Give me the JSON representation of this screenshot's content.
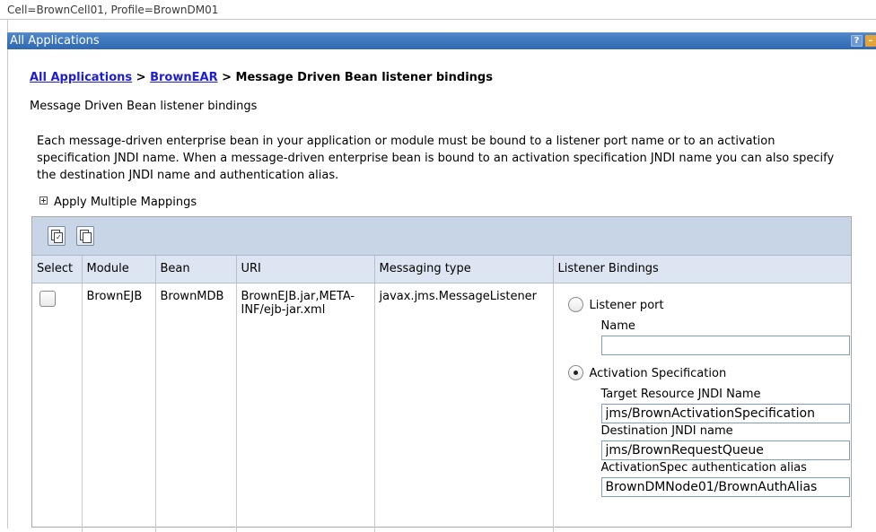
{
  "header": {
    "context": "Cell=BrownCell01, Profile=BrownDM01"
  },
  "panel": {
    "title": "All Applications",
    "help_label": "?",
    "minimize_label": "–"
  },
  "breadcrumb": {
    "link1": "All Applications",
    "sep1": " > ",
    "link2": "BrownEAR",
    "sep2": " > ",
    "current": "Message Driven Bean listener bindings"
  },
  "page": {
    "subtitle": "Message Driven Bean listener bindings",
    "description": "Each message-driven enterprise bean in your application or module must be bound to a listener port name or to an activation specification JNDI name. When a message-driven enterprise bean is bound to an activation specification JNDI name you can also specify the destination JNDI name and authentication alias.",
    "apply_multiple": "Apply Multiple Mappings"
  },
  "toolbar": {
    "icons": [
      "select-all-icon",
      "deselect-all-icon"
    ]
  },
  "table": {
    "headers": [
      "Select",
      "Module",
      "Bean",
      "URI",
      "Messaging type",
      "Listener Bindings"
    ],
    "row": {
      "selected": false,
      "module": "BrownEJB",
      "bean": "BrownMDB",
      "uri": "BrownEJB.jar,META-INF/ejb-jar.xml",
      "messaging_type": "javax.jms.MessageListener"
    }
  },
  "bindings": {
    "listener_port_label": "Listener port",
    "listener_port_selected": false,
    "name_label": "Name",
    "name_value": "",
    "activation_spec_label": "Activation Specification",
    "activation_spec_selected": true,
    "target_jndi_label": "Target Resource JNDI Name",
    "target_jndi_value": "jms/BrownActivationSpecification",
    "destination_jndi_label": "Destination JNDI name",
    "destination_jndi_value": "jms/BrownRequestQueue",
    "auth_alias_label": "ActivationSpec authentication alias",
    "auth_alias_value": "BrownDMNode01/BrownAuthAlias"
  }
}
